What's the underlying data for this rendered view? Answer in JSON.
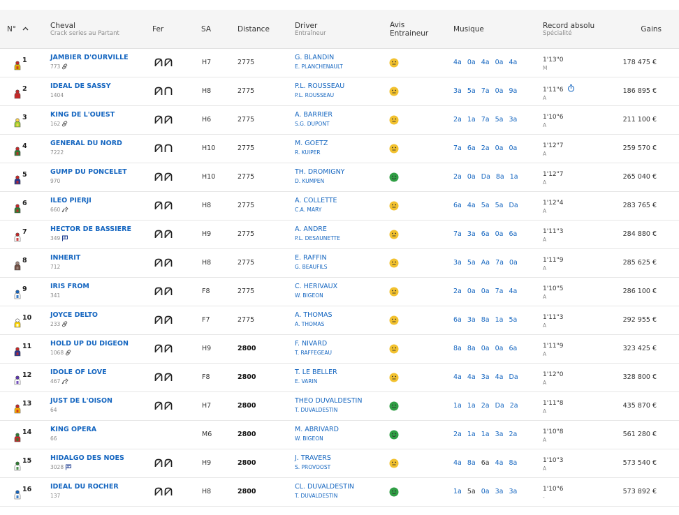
{
  "header": {
    "num": "N°",
    "cheval": "Cheval",
    "cheval_sub": "Crack series au Partant",
    "fer": "Fer",
    "sa": "SA",
    "distance": "Distance",
    "driver": "Driver",
    "driver_sub": "Entraîneur",
    "avis_1": "Avis",
    "avis_2": "Entraineur",
    "musique": "Musique",
    "record": "Record absolu",
    "record_sub": "Spécialité",
    "gains": "Gains"
  },
  "colors": {
    "link": "#1566c0",
    "happy_green": "#2f9e44",
    "neutral_yellow": "#f2c12e"
  },
  "rows": [
    {
      "num": "1",
      "silk": [
        "#e3b700",
        "#c62828"
      ],
      "name": "JAMBIER D'OURVILLE",
      "crack": "773",
      "tag": "link-icon",
      "fer": "DA4",
      "sa": "H7",
      "distance": "2775",
      "dist_bold": false,
      "driver": "G. BLANDIN",
      "trainer": "E. PLANCHENAULT",
      "avis": "neutral",
      "musique": [
        {
          "v": "4a"
        },
        {
          "v": "0a"
        },
        {
          "v": "4a"
        },
        {
          "v": "0a"
        },
        {
          "v": "4a"
        }
      ],
      "record": "1'13\"0",
      "stopwatch": false,
      "spec": "M",
      "gains": "178 475 €"
    },
    {
      "num": "2",
      "silk": [
        "#c62828",
        "#c62828"
      ],
      "name": "IDEAL DE SASSY",
      "crack": "1404",
      "tag": "",
      "fer": "DP",
      "sa": "H8",
      "distance": "2775",
      "dist_bold": false,
      "driver": "P.L. ROUSSEAU",
      "trainer": "P.L. ROUSSEAU",
      "avis": "neutral",
      "musique": [
        {
          "v": "3a"
        },
        {
          "v": "5a"
        },
        {
          "v": "7a"
        },
        {
          "v": "0a"
        },
        {
          "v": "9a"
        }
      ],
      "record": "1'11\"6",
      "stopwatch": true,
      "spec": "A",
      "gains": "186 895 €"
    },
    {
      "num": "3",
      "silk": [
        "#9acd32",
        "#ffd54f"
      ],
      "name": "KING DE L'OUEST",
      "crack": "162",
      "tag": "link-icon",
      "fer": "DA4",
      "sa": "H6",
      "distance": "2775",
      "dist_bold": false,
      "driver": "A. BARRIER",
      "trainer": "S.G. DUPONT",
      "avis": "neutral",
      "musique": [
        {
          "v": "2a"
        },
        {
          "v": "1a"
        },
        {
          "v": "7a"
        },
        {
          "v": "5a"
        },
        {
          "v": "3a"
        }
      ],
      "record": "1'10\"6",
      "stopwatch": false,
      "spec": "A",
      "gains": "211 100 €"
    },
    {
      "num": "4",
      "silk": [
        "#2e7d32",
        "#c62828"
      ],
      "name": "GENERAL DU NORD",
      "crack": "7222",
      "tag": "",
      "fer": "DP",
      "sa": "H10",
      "distance": "2775",
      "dist_bold": false,
      "driver": "M. GOETZ",
      "trainer": "R. KUIPER",
      "avis": "neutral",
      "musique": [
        {
          "v": "7a"
        },
        {
          "v": "6a"
        },
        {
          "v": "2a"
        },
        {
          "v": "0a"
        },
        {
          "v": "0a"
        }
      ],
      "record": "1'12\"7",
      "stopwatch": false,
      "spec": "A",
      "gains": "259 570 €"
    },
    {
      "num": "5",
      "silk": [
        "#283593",
        "#c62828"
      ],
      "name": "GUMP DU PONCELET",
      "crack": "970",
      "tag": "",
      "fer": "DA4",
      "sa": "H10",
      "distance": "2775",
      "dist_bold": false,
      "driver": "TH. DROMIGNY",
      "trainer": "D. KUMPEN",
      "avis": "happy",
      "musique": [
        {
          "v": "2a"
        },
        {
          "v": "0a"
        },
        {
          "v": "Da"
        },
        {
          "v": "8a"
        },
        {
          "v": "1a"
        }
      ],
      "record": "1'12\"7",
      "stopwatch": false,
      "spec": "A",
      "gains": "265 040 €"
    },
    {
      "num": "6",
      "silk": [
        "#2e7d32",
        "#c62828"
      ],
      "name": "ILEO PIERJI",
      "crack": "660",
      "tag": "horse-icon",
      "fer": "DA4",
      "sa": "H8",
      "distance": "2775",
      "dist_bold": false,
      "driver": "A. COLLETTE",
      "trainer": "C.A. MARY",
      "avis": "neutral",
      "musique": [
        {
          "v": "6a"
        },
        {
          "v": "4a"
        },
        {
          "v": "5a"
        },
        {
          "v": "5a"
        },
        {
          "v": "Da"
        }
      ],
      "record": "1'12\"4",
      "stopwatch": false,
      "spec": "A",
      "gains": "283 765 €"
    },
    {
      "num": "7",
      "silk": [
        "#ffffff",
        "#c62828"
      ],
      "name": "HECTOR DE BASSIERE",
      "crack": "349",
      "tag": "flag-icon",
      "fer": "DA4",
      "sa": "H9",
      "distance": "2775",
      "dist_bold": false,
      "driver": "A. ANDRE",
      "trainer": "P.L. DESAUNETTE",
      "avis": "neutral",
      "musique": [
        {
          "v": "7a"
        },
        {
          "v": "3a"
        },
        {
          "v": "6a"
        },
        {
          "v": "0a"
        },
        {
          "v": "6a"
        }
      ],
      "record": "1'11\"3",
      "stopwatch": false,
      "spec": "A",
      "gains": "284 880 €"
    },
    {
      "num": "8",
      "silk": [
        "#6d4c41",
        "#a1887f"
      ],
      "name": "INHERIT",
      "crack": "712",
      "tag": "",
      "fer": "DA4",
      "sa": "H8",
      "distance": "2775",
      "dist_bold": false,
      "driver": "E. RAFFIN",
      "trainer": "G. BEAUFILS",
      "avis": "neutral",
      "musique": [
        {
          "v": "3a"
        },
        {
          "v": "5a"
        },
        {
          "v": "Aa"
        },
        {
          "v": "7a"
        },
        {
          "v": "0a"
        }
      ],
      "record": "1'11\"9",
      "stopwatch": false,
      "spec": "A",
      "gains": "285 625 €"
    },
    {
      "num": "9",
      "silk": [
        "#ffffff",
        "#1565c0"
      ],
      "name": "IRIS FROM",
      "crack": "341",
      "tag": "",
      "fer": "DA4",
      "sa": "F8",
      "distance": "2775",
      "dist_bold": false,
      "driver": "C. HERIVAUX",
      "trainer": "W. BIGEON",
      "avis": "neutral",
      "musique": [
        {
          "v": "2a"
        },
        {
          "v": "0a"
        },
        {
          "v": "0a"
        },
        {
          "v": "7a"
        },
        {
          "v": "4a"
        }
      ],
      "record": "1'10\"5",
      "stopwatch": false,
      "spec": "A",
      "gains": "286 100 €"
    },
    {
      "num": "10",
      "silk": [
        "#ffd600",
        "#ffffff"
      ],
      "name": "JOYCE DELTO",
      "crack": "233",
      "tag": "link-icon",
      "fer": "DA4",
      "sa": "F7",
      "distance": "2775",
      "dist_bold": false,
      "driver": "A. THOMAS",
      "trainer": "A. THOMAS",
      "avis": "neutral",
      "musique": [
        {
          "v": "6a"
        },
        {
          "v": "3a"
        },
        {
          "v": "8a"
        },
        {
          "v": "1a"
        },
        {
          "v": "5a"
        }
      ],
      "record": "1'11\"3",
      "stopwatch": false,
      "spec": "A",
      "gains": "292 955 €"
    },
    {
      "num": "11",
      "silk": [
        "#283593",
        "#c62828"
      ],
      "name": "HOLD UP DU DIGEON",
      "crack": "1068",
      "tag": "link-icon",
      "fer": "DA4",
      "sa": "H9",
      "distance": "2800",
      "dist_bold": true,
      "driver": "F. NIVARD",
      "trainer": "T. RAFFEGEAU",
      "avis": "neutral",
      "musique": [
        {
          "v": "8a"
        },
        {
          "v": "8a"
        },
        {
          "v": "0a"
        },
        {
          "v": "0a"
        },
        {
          "v": "6a"
        }
      ],
      "record": "1'11\"9",
      "stopwatch": false,
      "spec": "A",
      "gains": "323 425 €"
    },
    {
      "num": "12",
      "silk": [
        "#ffffff",
        "#5e35b1"
      ],
      "name": "IDOLE OF LOVE",
      "crack": "467",
      "tag": "horse-icon",
      "fer": "DA4",
      "sa": "F8",
      "distance": "2800",
      "dist_bold": true,
      "driver": "T. LE BELLER",
      "trainer": "E. VARIN",
      "avis": "neutral",
      "musique": [
        {
          "v": "4a"
        },
        {
          "v": "4a"
        },
        {
          "v": "3a"
        },
        {
          "v": "4a"
        },
        {
          "v": "Da"
        }
      ],
      "record": "1'12\"0",
      "stopwatch": false,
      "spec": "A",
      "gains": "328 800 €"
    },
    {
      "num": "13",
      "silk": [
        "#ffb300",
        "#c62828"
      ],
      "name": "JUST DE L'OISON",
      "crack": "64",
      "tag": "",
      "fer": "DA4",
      "sa": "H7",
      "distance": "2800",
      "dist_bold": true,
      "driver": "THEO DUVALDESTIN",
      "trainer": "T. DUVALDESTIN",
      "avis": "happy",
      "musique": [
        {
          "v": "1a"
        },
        {
          "v": "1a"
        },
        {
          "v": "2a"
        },
        {
          "v": "Da"
        },
        {
          "v": "2a"
        }
      ],
      "record": "1'11\"8",
      "stopwatch": false,
      "spec": "A",
      "gains": "435 870 €"
    },
    {
      "num": "14",
      "silk": [
        "#c62828",
        "#2e7d32"
      ],
      "name": "KING OPERA",
      "crack": "66",
      "tag": "",
      "fer": "",
      "sa": "M6",
      "distance": "2800",
      "dist_bold": true,
      "driver": "M. ABRIVARD",
      "trainer": "W. BIGEON",
      "avis": "happy",
      "musique": [
        {
          "v": "2a"
        },
        {
          "v": "1a"
        },
        {
          "v": "1a"
        },
        {
          "v": "3a"
        },
        {
          "v": "2a"
        }
      ],
      "record": "1'10\"8",
      "stopwatch": false,
      "spec": "A",
      "gains": "561 280 €"
    },
    {
      "num": "15",
      "silk": [
        "#ffffff",
        "#2e7d32"
      ],
      "name": "HIDALGO DES NOES",
      "crack": "3028",
      "tag": "flag-icon",
      "fer": "DA4",
      "sa": "H9",
      "distance": "2800",
      "dist_bold": true,
      "driver": "J. TRAVERS",
      "trainer": "S. PROVOOST",
      "avis": "neutral",
      "musique": [
        {
          "v": "4a"
        },
        {
          "v": "8a"
        },
        {
          "v": "6a",
          "dark": true
        },
        {
          "v": "4a"
        },
        {
          "v": "8a"
        }
      ],
      "record": "1'10\"3",
      "stopwatch": false,
      "spec": "A",
      "gains": "573 540 €"
    },
    {
      "num": "16",
      "silk": [
        "#ffffff",
        "#1565c0"
      ],
      "name": "IDEAL DU ROCHER",
      "crack": "137",
      "tag": "",
      "fer": "DA4",
      "sa": "H8",
      "distance": "2800",
      "dist_bold": true,
      "driver": "CL. DUVALDESTIN",
      "trainer": "T. DUVALDESTIN",
      "avis": "happy",
      "musique": [
        {
          "v": "1a"
        },
        {
          "v": "5a",
          "dark": true
        },
        {
          "v": "0a"
        },
        {
          "v": "3a"
        },
        {
          "v": "3a"
        }
      ],
      "record": "1'10\"6",
      "stopwatch": false,
      "spec": "-",
      "gains": "573 892 €"
    }
  ]
}
